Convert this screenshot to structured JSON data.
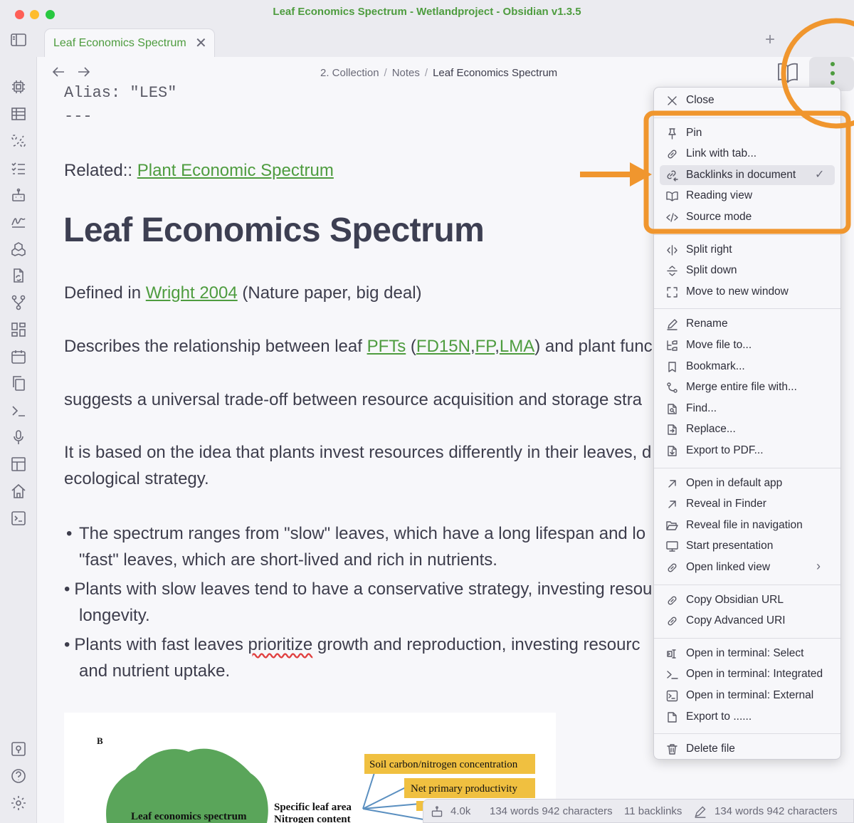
{
  "window": {
    "title": "Leaf Economics Spectrum - Wetlandproject - Obsidian v1.3.5"
  },
  "tab": {
    "label": "Leaf Economics Spectrum",
    "close": "✕",
    "new": "+"
  },
  "breadcrumb": {
    "items": [
      "2. Collection",
      "Notes",
      "Leaf Economics Spectrum"
    ],
    "sep": "/"
  },
  "note": {
    "frontmatter_alias": "Alias: \"LES\"",
    "frontmatter_end": "---",
    "related_label": "Related::",
    "related_link": "Plant Economic Spectrum",
    "heading": "Leaf Economics Spectrum",
    "p1": {
      "pre": "Defined in ",
      "link": "Wright 2004",
      "post": " (Nature paper, big deal)"
    },
    "p2": {
      "pre": "Describes the relationship between leaf ",
      "l1": "PFTs",
      "o": " (",
      "l2": "FD15N",
      "c1": ",",
      "l3": "FP",
      "c2": ",",
      "l4": "LMA",
      "post": ") and plant func"
    },
    "p3": "suggests a universal trade-off between resource acquisition and storage stra",
    "p4a": "It is based on the idea that plants invest resources differently in their leaves, d",
    "p4b": "ecological strategy.",
    "bullets": [
      {
        "l1": "The spectrum ranges from \"slow\" leaves, which have a long lifespan and lo",
        "l2": "\"fast\" leaves, which are short-lived and rich in nutrients."
      },
      {
        "l1": "Plants with slow leaves tend to have a conservative strategy, investing resou",
        "l2": "longevity."
      },
      {
        "pre": "Plants with fast leaves ",
        "err": "prioritize",
        "post": " growth and reproduction, investing resourc",
        "l2": "and nutrient uptake."
      }
    ],
    "figure": {
      "panel": "B",
      "center": "Leaf economics spectrum",
      "mid1": "Specific leaf area",
      "mid2": "Nitrogen content",
      "box1": "Soil carbon/nitrogen concentration",
      "box2": "Net primary productivity"
    }
  },
  "status": {
    "count": "4.0k",
    "s1": "134 words 942 characters",
    "backlinks": "11 backlinks",
    "s2": "134 words  942 characters"
  },
  "menu": {
    "groups": [
      [
        {
          "icon": "close-icon",
          "label": "Close"
        }
      ],
      [
        {
          "icon": "pin-icon",
          "label": "Pin"
        },
        {
          "icon": "link-icon",
          "label": "Link with tab..."
        },
        {
          "icon": "backlinks-icon",
          "label": "Backlinks in document",
          "checked": true
        },
        {
          "icon": "book-open-icon",
          "label": "Reading view"
        },
        {
          "icon": "code-icon",
          "label": "Source mode"
        }
      ],
      [
        {
          "icon": "split-right-icon",
          "label": "Split right"
        },
        {
          "icon": "split-down-icon",
          "label": "Split down"
        },
        {
          "icon": "new-window-icon",
          "label": "Move to new window"
        }
      ],
      [
        {
          "icon": "pencil-icon",
          "label": "Rename"
        },
        {
          "icon": "folder-tree-icon",
          "label": "Move file to..."
        },
        {
          "icon": "bookmark-icon",
          "label": "Bookmark..."
        },
        {
          "icon": "merge-icon",
          "label": "Merge entire file with..."
        },
        {
          "icon": "file-search-icon",
          "label": "Find..."
        },
        {
          "icon": "file-replace-icon",
          "label": "Replace..."
        },
        {
          "icon": "file-export-icon",
          "label": "Export to PDF..."
        }
      ],
      [
        {
          "icon": "arrow-up-right-icon",
          "label": "Open in default app"
        },
        {
          "icon": "arrow-up-right-icon",
          "label": "Reveal in Finder"
        },
        {
          "icon": "folder-open-icon",
          "label": "Reveal file in navigation"
        },
        {
          "icon": "monitor-icon",
          "label": "Start presentation"
        },
        {
          "icon": "link-icon",
          "label": "Open linked view",
          "submenu": true
        }
      ],
      [
        {
          "icon": "link-icon",
          "label": "Copy Obsidian URL"
        },
        {
          "icon": "link-icon",
          "label": "Copy Advanced URI"
        }
      ],
      [
        {
          "icon": "terminal-select-icon",
          "label": "Open in terminal: Select"
        },
        {
          "icon": "terminal-icon",
          "label": "Open in terminal: Integrated"
        },
        {
          "icon": "terminal-square-icon",
          "label": "Open in terminal: External"
        },
        {
          "icon": "file-icon",
          "label": "Export to ......"
        }
      ],
      [
        {
          "icon": "trash-icon",
          "label": "Delete file"
        }
      ]
    ],
    "check": "✓",
    "submenu_arrow": "›"
  },
  "colors": {
    "accent": "#4e9c3f",
    "annotation": "#f0962e",
    "menu_bg": "#f7f7fa"
  }
}
